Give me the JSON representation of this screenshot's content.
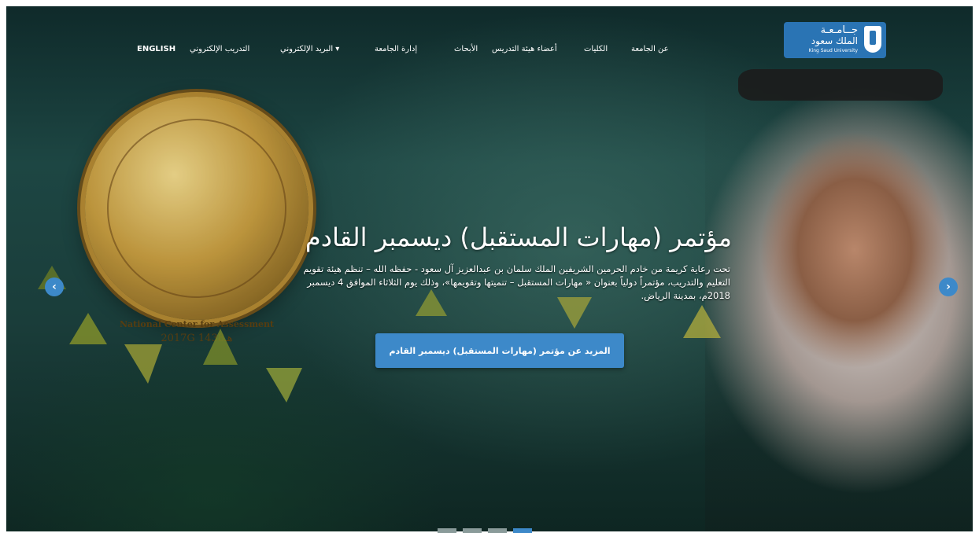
{
  "logo": {
    "arabic_line1": "جــامـعـة",
    "arabic_line2": "الملك سعود",
    "english": "King Saud University"
  },
  "nav": {
    "items": [
      {
        "label": "عن الجامعة"
      },
      {
        "label": "الكليات"
      },
      {
        "label": "أعضاء هيئة التدريس"
      },
      {
        "label": "الأبحاث"
      },
      {
        "label": "إدارة الجامعة"
      },
      {
        "label": "البريد الإلكتروني ▾"
      },
      {
        "label": "التدريب الإلكتروني"
      },
      {
        "label": "ENGLISH"
      }
    ]
  },
  "medal": {
    "english": "National Center for Assessment",
    "year": "2017G 1438هـ"
  },
  "slide": {
    "headline": "مؤتمر (مهارات المستقبل) ديسمبر القادم",
    "lead": "تحت رعاية كريمة من خادم الحرمين الشريفين الملك سلمان بن عبدالعزيز آل سعود - حفظه الله – تنظم هيئة تقويم التعليم والتدريب، مؤتمراً دولياً بعنوان « مهارات المستقبل – تنميتها وتقويمها»، وذلك يوم الثلاثاء الموافق 4 ديسمبر 2018م، بمدينة الرياض.",
    "cta": "المزيد عن مؤتمر (مهارات المستقبل) ديسمبر القادم"
  },
  "carousel": {
    "prev_glyph": "‹",
    "next_glyph": "›",
    "active_index": 3,
    "count": 4
  },
  "colors": {
    "accent": "#3d89c9",
    "logo_bg": "#2a74b4"
  }
}
